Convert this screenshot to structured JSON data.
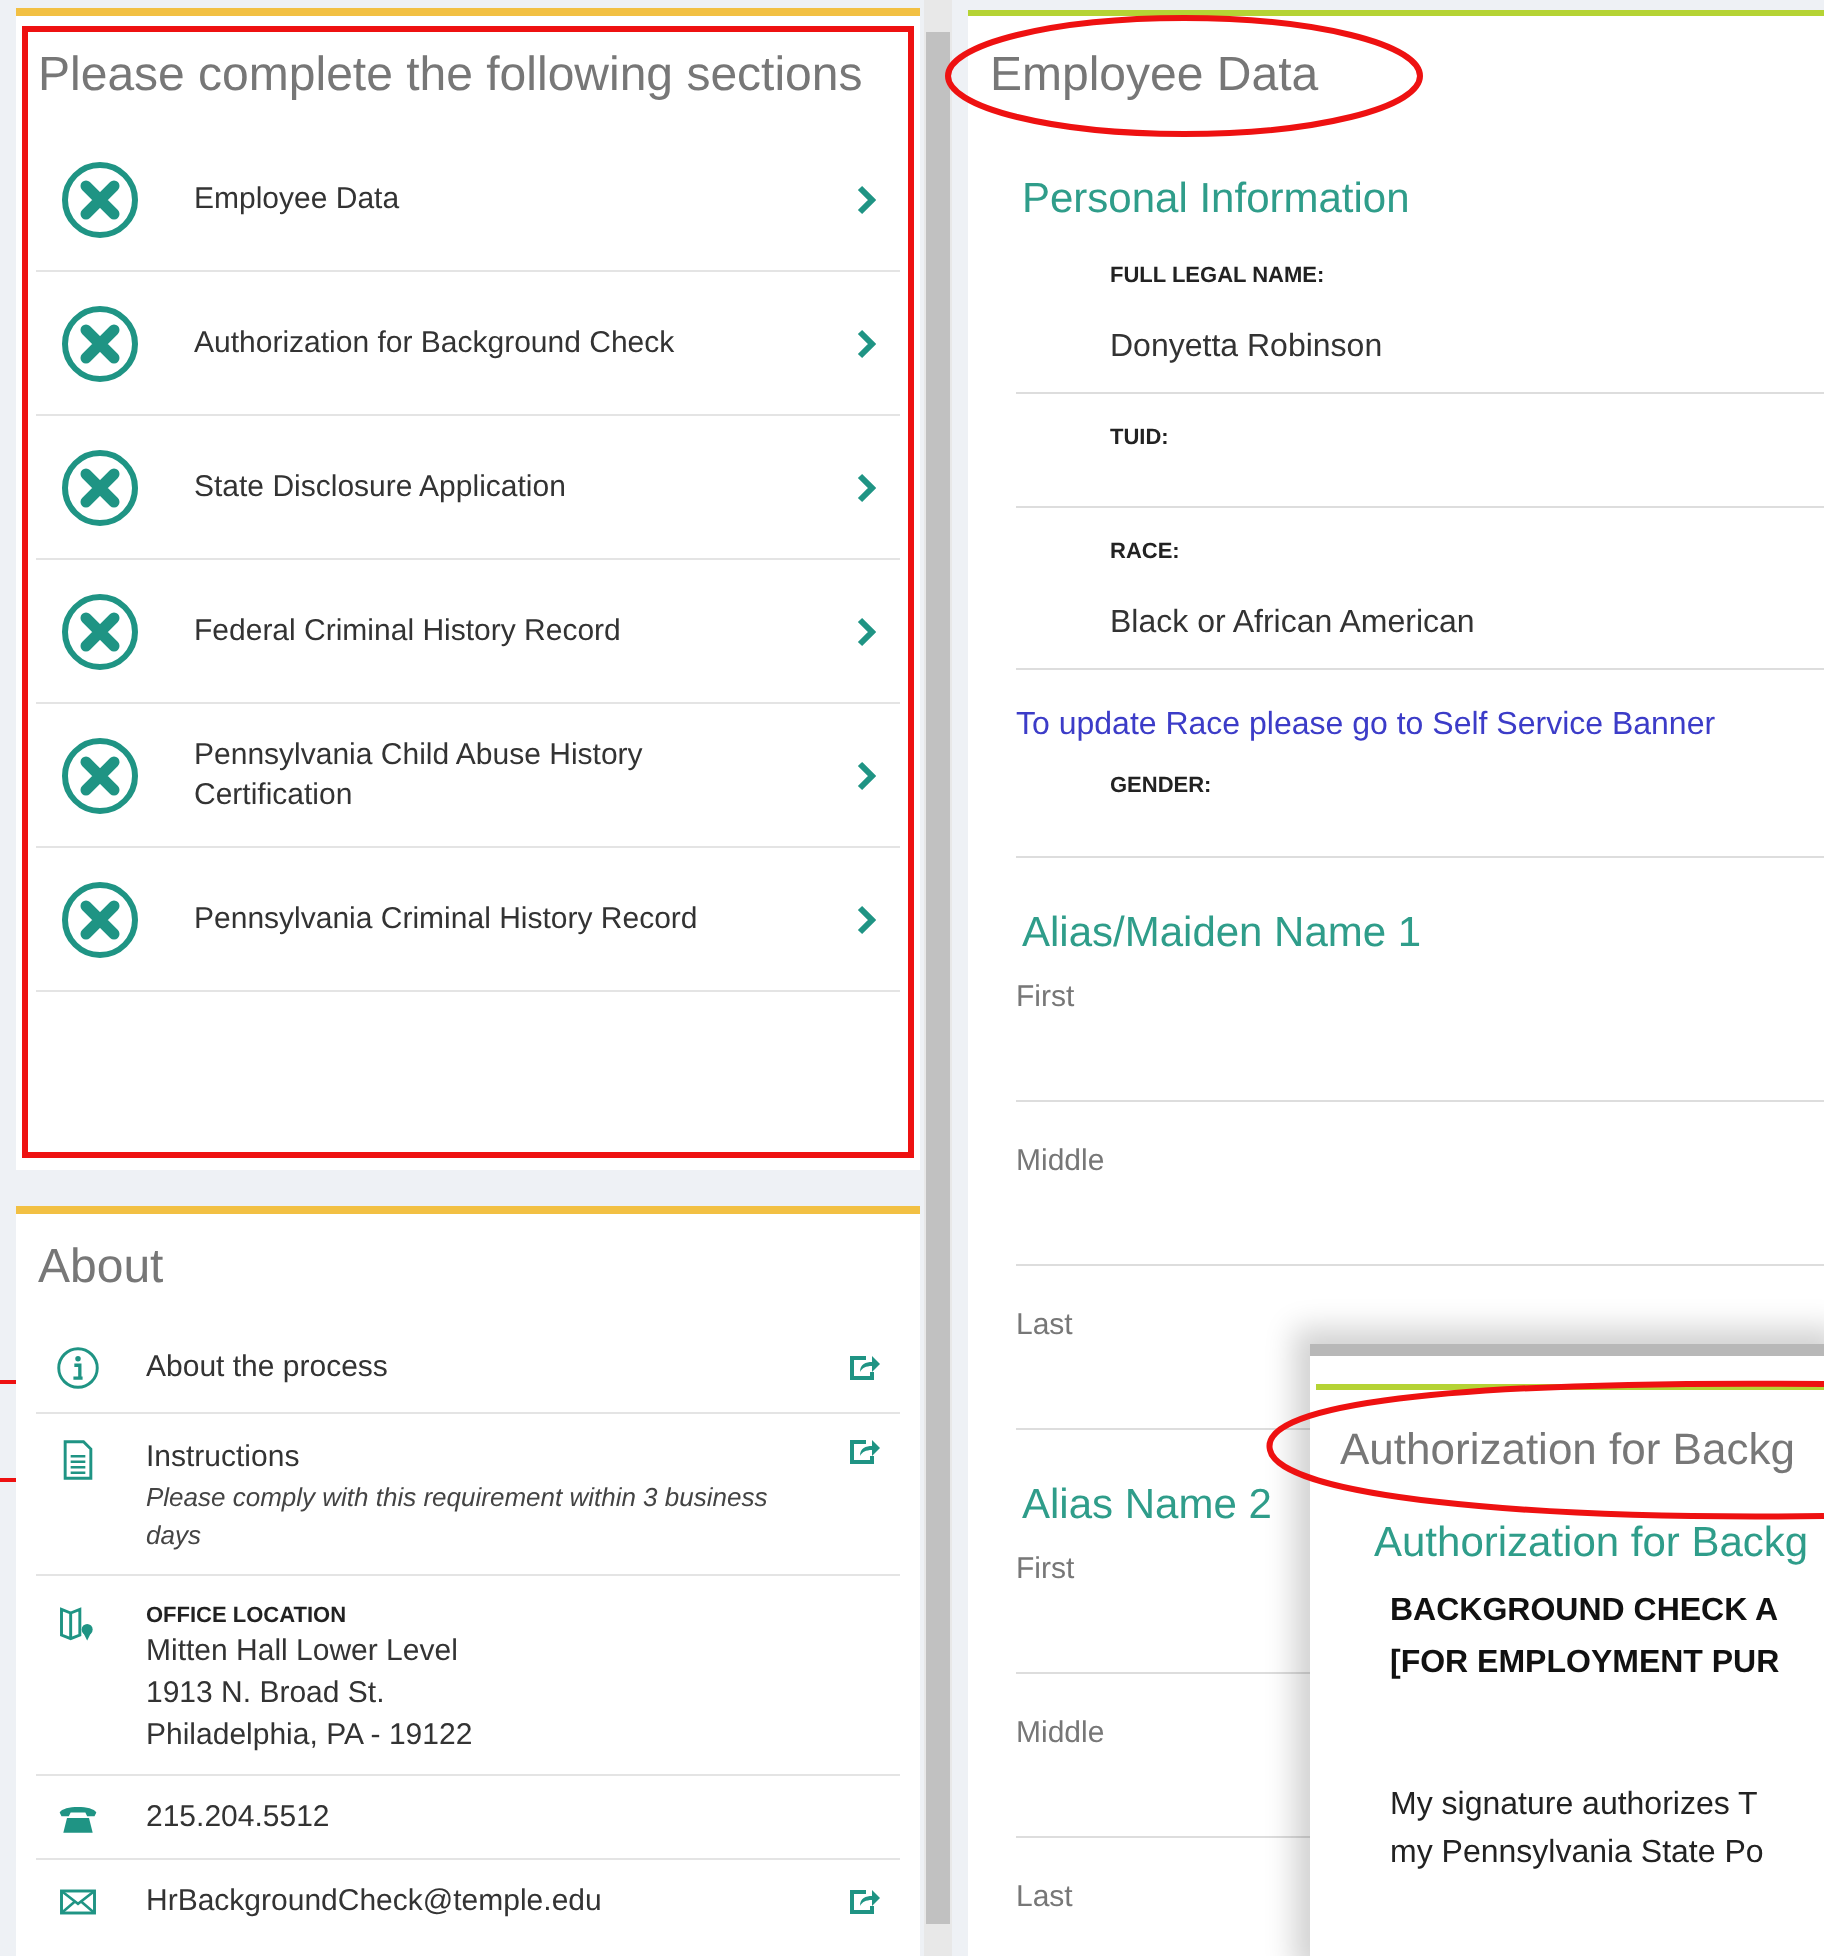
{
  "sections_panel": {
    "title": "Please complete the following sections",
    "items": [
      {
        "label": "Employee Data",
        "complete": false
      },
      {
        "label": "Authorization for Background Check",
        "complete": false
      },
      {
        "label": "State Disclosure Application",
        "complete": false
      },
      {
        "label": "Federal Criminal History Record",
        "complete": false
      },
      {
        "label": "Pennsylvania Child Abuse History Certification",
        "complete": false
      },
      {
        "label": "Pennsylvania Criminal History Record",
        "complete": false
      }
    ]
  },
  "about_panel": {
    "title": "About",
    "items": [
      {
        "kind": "process",
        "label": "About the process",
        "external": true
      },
      {
        "kind": "instructions",
        "label": "Instructions",
        "note": "Please comply with this requirement within 3 business days",
        "external": true
      },
      {
        "kind": "location",
        "heading": "OFFICE LOCATION",
        "lines": [
          "Mitten Hall Lower Level",
          "1913 N. Broad St.",
          "Philadelphia, PA - 19122"
        ],
        "external": false
      },
      {
        "kind": "phone",
        "label": "215.204.5512",
        "external": false
      },
      {
        "kind": "email",
        "label": "HrBackgroundCheck@temple.edu",
        "external": true
      }
    ]
  },
  "employee_data": {
    "title": "Employee Data",
    "sections": [
      {
        "heading": "Personal Information",
        "fields": [
          {
            "kind": "field",
            "label": "FULL LEGAL NAME:",
            "value": "Donyetta Robinson"
          },
          {
            "kind": "field",
            "label": "TUID:"
          },
          {
            "kind": "field",
            "label": "RACE:",
            "value": "Black or African American"
          },
          {
            "kind": "link",
            "label": "To update Race please go to Self Service Banner"
          },
          {
            "kind": "field",
            "label": "GENDER:"
          }
        ]
      },
      {
        "heading": "Alias/Maiden Name 1",
        "fields": [
          {
            "kind": "input",
            "label": "First"
          },
          {
            "kind": "input",
            "label": "Middle"
          },
          {
            "kind": "input",
            "label": "Last"
          }
        ]
      },
      {
        "heading": "Alias Name 2",
        "fields": [
          {
            "kind": "input",
            "label": "First"
          },
          {
            "kind": "input",
            "label": "Middle"
          },
          {
            "kind": "input",
            "label": "Last"
          }
        ]
      }
    ]
  },
  "popup": {
    "title": "Authorization for Backg",
    "heading": "Authorization for Backg",
    "bold_lines": [
      "BACKGROUND CHECK A",
      "[FOR EMPLOYMENT PUR"
    ],
    "paragraph_lines": [
      "My signature authorizes T",
      "my Pennsylvania State Po"
    ]
  }
}
